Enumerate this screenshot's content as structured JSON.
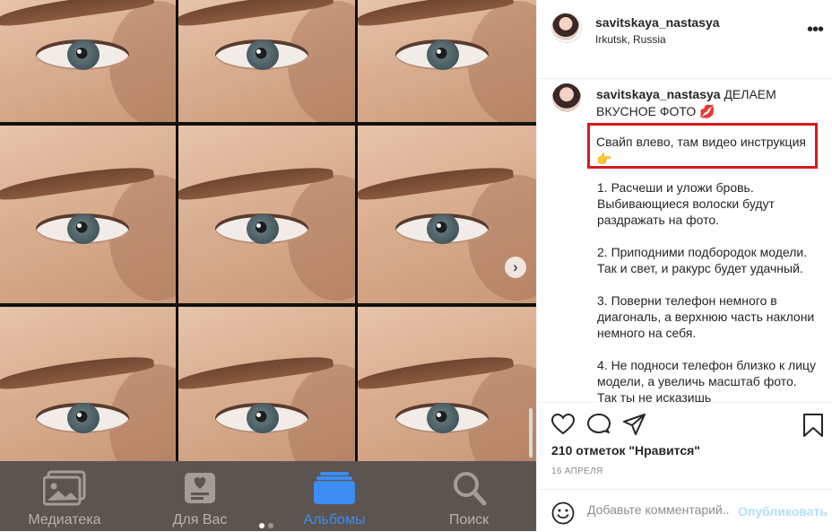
{
  "post": {
    "username": "savitskaya_nastasya",
    "location": "Irkutsk, Russia",
    "more_icon": "more-horizontal-icon",
    "caption_head": "ДЕЛАЕМ ВКУСНОЕ ФОТО 💋",
    "caption_highlight": "Свайп влево, там видео инструкция 👉",
    "caption_items": [
      "1. Расчеши и уложи бровь. Выбивающиеся волоски будут раздражать на фото.",
      "2. Приподними подбородок модели. Так и свет, и ракурс будет удачный.",
      "3. Поверни телефон немного в диагональ, а верхнюю часть наклони немного на себя.",
      "4. Не подноси телефон близко к лицу модели, а увеличь масштаб фото. Так ты не исказишь"
    ],
    "likes": "210 отметок \"Нравится\"",
    "date": "16 АПРЕЛЯ",
    "highlight_color": "#d31c1c"
  },
  "comment": {
    "placeholder": "Добавьте комментарий...",
    "publish": "Опубликовать",
    "publish_color": "#b2dffc"
  },
  "media": {
    "next_icon": "chevron-right-icon",
    "carousel_position": 1,
    "carousel_count": 2
  },
  "phone_tabs": [
    {
      "label": "Медиатека",
      "icon": "photos-library-icon"
    },
    {
      "label": "Для Вас",
      "icon": "for-you-icon"
    },
    {
      "label": "Альбомы",
      "icon": "albums-icon",
      "active": true
    },
    {
      "label": "Поиск",
      "icon": "search-icon"
    }
  ],
  "colors": {
    "accent": "#3d8df3",
    "text": "#262626",
    "muted": "#8e8e8e"
  }
}
